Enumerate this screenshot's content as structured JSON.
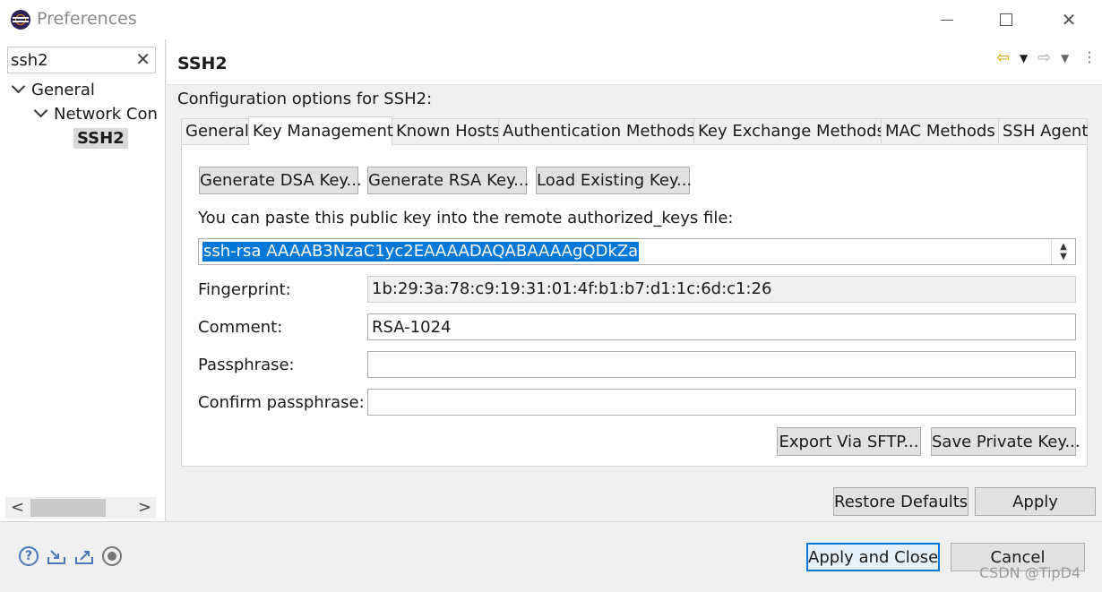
{
  "window": {
    "title": "Preferences",
    "close_glyph": "✕",
    "accent_color": "#0078d7"
  },
  "filter": {
    "value": "ssh2",
    "clear_glyph": "✕"
  },
  "tree": {
    "items": [
      {
        "label": "General",
        "expanded": true
      },
      {
        "label": "Network Con",
        "expanded": true
      },
      {
        "label": "SSH2",
        "selected": true
      }
    ]
  },
  "left_scroll": {
    "left_glyph": "<",
    "right_glyph": ">"
  },
  "page": {
    "title": "SSH2",
    "description": "Configuration options for SSH2:",
    "nav": {
      "back_glyph": "⇦",
      "forward_glyph": "⇨",
      "menu_glyph": "▼",
      "more_glyph": "⋮"
    }
  },
  "tabs": [
    {
      "label": "General"
    },
    {
      "label": "Key Management",
      "active": true
    },
    {
      "label": "Known Hosts"
    },
    {
      "label": "Authentication Methods"
    },
    {
      "label": "Key Exchange Methods"
    },
    {
      "label": "MAC Methods"
    },
    {
      "label": "SSH Agent"
    }
  ],
  "key_management": {
    "gen_dsa_label": "Generate DSA Key...",
    "gen_rsa_label": "Generate RSA Key...",
    "load_key_label": "Load Existing Key...",
    "paste_hint": "You can paste this public key into the remote authorized_keys file:",
    "public_key": "ssh-rsa AAAAB3NzaC1yc2EAAAADAQABAAAAgQDkZa",
    "spin_up": "▲",
    "spin_down": "▼",
    "fingerprint_label": "Fingerprint:",
    "fingerprint_value": "1b:29:3a:78:c9:19:31:01:4f:b1:b7:d1:1c:6d:c1:26",
    "comment_label": "Comment:",
    "comment_value": "RSA-1024",
    "passphrase_label": "Passphrase:",
    "passphrase_value": "",
    "confirm_label": "Confirm passphrase:",
    "confirm_value": "",
    "export_label": "Export Via SFTP...",
    "save_private_label": "Save Private Key..."
  },
  "page_buttons": {
    "restore_label": "Restore Defaults",
    "apply_label": "Apply"
  },
  "footer": {
    "help_glyph": "?",
    "apply_close_label": "Apply and Close",
    "cancel_label": "Cancel",
    "watermark": "CSDN @TipD4"
  }
}
